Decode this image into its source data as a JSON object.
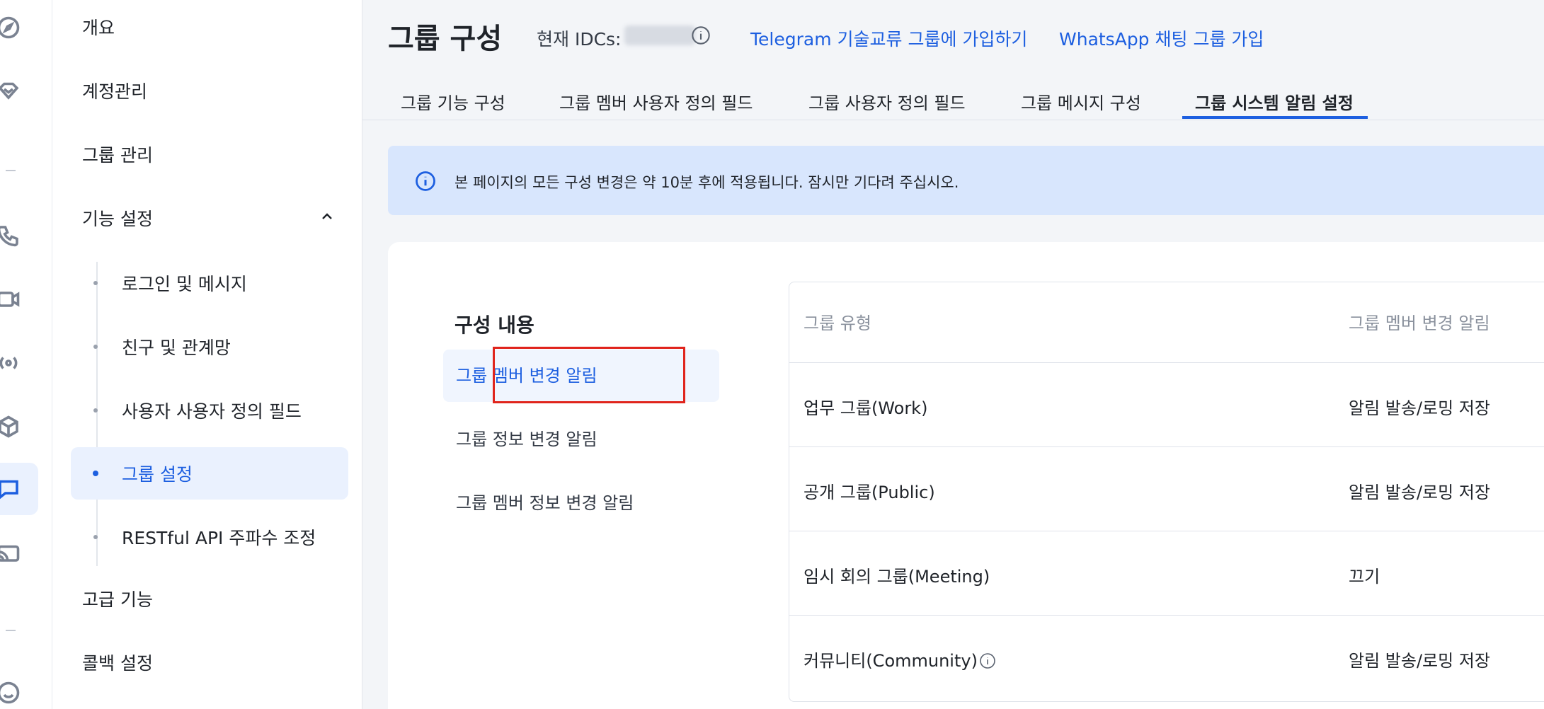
{
  "sidebar": {
    "items": [
      {
        "label": "개요"
      },
      {
        "label": "계정관리"
      },
      {
        "label": "그룹 관리"
      },
      {
        "label": "기능 설정"
      }
    ],
    "sub_items": [
      {
        "label": "로그인 및 메시지"
      },
      {
        "label": "친구 및 관계망"
      },
      {
        "label": "사용자 사용자 정의 필드"
      },
      {
        "label": "그룹 설정"
      },
      {
        "label": "RESTful API 주파수 조정"
      }
    ],
    "bottom_items": [
      {
        "label": "고급 기능"
      },
      {
        "label": "콜백 설정"
      }
    ]
  },
  "header": {
    "title": "그룹 구성",
    "idc_label": "현재 IDCs:",
    "links": [
      {
        "label": "Telegram 기술교류 그룹에 가입하기"
      },
      {
        "label": "WhatsApp 채팅 그룹 가입"
      }
    ]
  },
  "tabs": [
    {
      "label": "그룹 기능 구성"
    },
    {
      "label": "그룹 멤버 사용자 정의 필드"
    },
    {
      "label": "그룹 사용자 정의 필드"
    },
    {
      "label": "그룹 메시지 구성"
    },
    {
      "label": "그룹 시스템 알림 설정"
    }
  ],
  "notice": {
    "text": "본 페이지의 모든 구성 변경은 약 10분 후에 적용됩니다. 잠시만 기다려 주십시오."
  },
  "config": {
    "title": "구성 내용",
    "menu": [
      {
        "label": "그룹 멤버 변경 알림"
      },
      {
        "label": "그룹 정보 변경 알림"
      },
      {
        "label": "그룹 멤버 정보 변경 알림"
      }
    ]
  },
  "table": {
    "headers": [
      "그룹 유형",
      "그룹 멤버 변경 알림"
    ],
    "rows": [
      {
        "type": "업무 그룹(Work)",
        "value": "알림 발송/로밍 저장"
      },
      {
        "type": "공개 그룹(Public)",
        "value": "알림 발송/로밍 저장"
      },
      {
        "type": "임시 회의 그룹(Meeting)",
        "value": "끄기"
      },
      {
        "type": "커뮤니티(Community)",
        "value": "알림 발송/로밍 저장"
      }
    ]
  },
  "colors": {
    "accent": "#1d5fe0",
    "highlight_box": "#e0241c",
    "notice_bg": "#d8e6fd"
  }
}
